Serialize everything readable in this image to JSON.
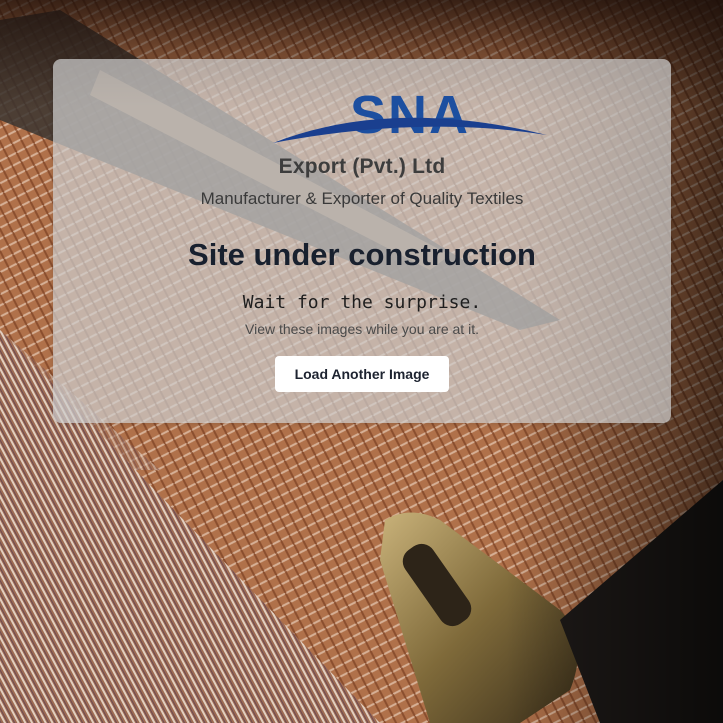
{
  "background": {
    "image_subject": "woven-textile-loom-shuttle"
  },
  "card": {
    "logo": {
      "wordmark": "SNA",
      "colors": {
        "wordmark": "#1c4fa0",
        "swoosh": "#1a3f8f"
      }
    },
    "company_name": "Export (Pvt.) Ltd",
    "tagline": "Manufacturer & Exporter of Quality Textiles",
    "headline": "Site under construction",
    "subline": "Wait for the surprise.",
    "note": "View these images while you are at it.",
    "button_label": "Load Another Image"
  }
}
